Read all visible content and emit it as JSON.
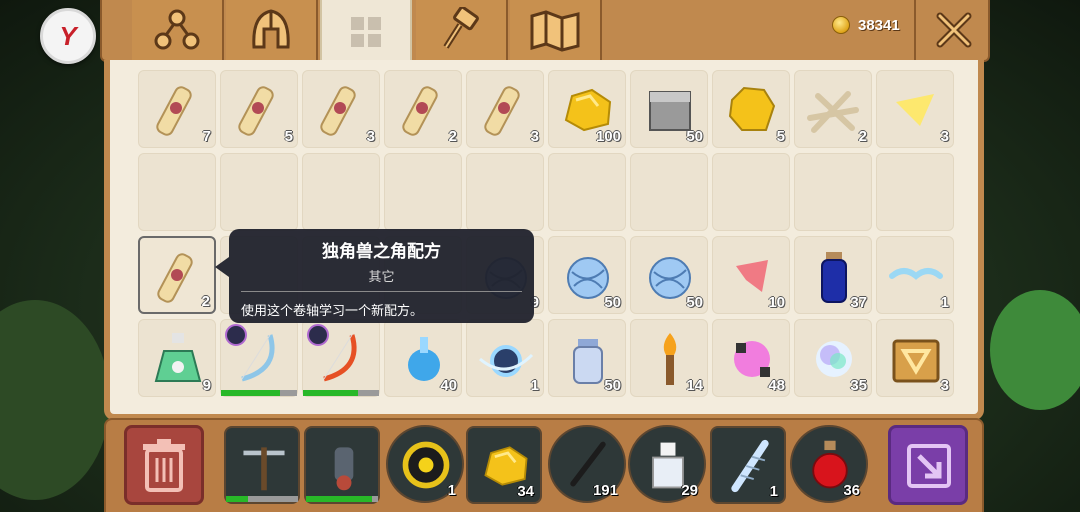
{
  "currency": {
    "coins": "38341",
    "icon": "gold-coin-icon"
  },
  "tabs": [
    {
      "name": "tab-skills",
      "icon": "skill-tree-icon"
    },
    {
      "name": "tab-equipment",
      "icon": "helmet-icon"
    },
    {
      "name": "tab-inventory",
      "icon": "grid-icon",
      "active": true
    },
    {
      "name": "tab-crafting",
      "icon": "hammer-icon"
    },
    {
      "name": "tab-map",
      "icon": "map-icon"
    }
  ],
  "inventory": {
    "rows": [
      [
        {
          "item": "scroll",
          "count": "7"
        },
        {
          "item": "scroll",
          "count": "5"
        },
        {
          "item": "scroll",
          "count": "3"
        },
        {
          "item": "scroll",
          "count": "2"
        },
        {
          "item": "scroll",
          "count": "3"
        },
        {
          "item": "gold-ore",
          "count": "100"
        },
        {
          "item": "stone-block",
          "count": "50"
        },
        {
          "item": "yellow-chunk",
          "count": "5"
        },
        {
          "item": "bones",
          "count": "2"
        },
        {
          "item": "yellow-shard",
          "count": "3"
        }
      ],
      [
        {
          "item": "",
          "count": ""
        },
        {
          "item": "",
          "count": ""
        },
        {
          "item": "",
          "count": ""
        },
        {
          "item": "",
          "count": ""
        },
        {
          "item": "",
          "count": ""
        },
        {
          "item": "",
          "count": ""
        },
        {
          "item": "",
          "count": ""
        },
        {
          "item": "",
          "count": ""
        },
        {
          "item": "",
          "count": ""
        },
        {
          "item": "",
          "count": ""
        }
      ],
      [
        {
          "item": "scroll",
          "count": "2",
          "selected": true
        },
        {
          "item": "hidden",
          "count": ""
        },
        {
          "item": "hidden",
          "count": ""
        },
        {
          "item": "hidden",
          "count": ""
        },
        {
          "item": "yarn",
          "count": "9"
        },
        {
          "item": "yarn",
          "count": "50"
        },
        {
          "item": "yarn",
          "count": "50"
        },
        {
          "item": "pink-cloth",
          "count": "10"
        },
        {
          "item": "blue-vial",
          "count": "37"
        },
        {
          "item": "wing",
          "count": "1"
        }
      ],
      [
        {
          "item": "green-potion",
          "count": "9"
        },
        {
          "item": "lightning-bow",
          "count": "",
          "durability": 0.78
        },
        {
          "item": "fire-bow",
          "count": "",
          "durability": 0.72
        },
        {
          "item": "blue-bomb",
          "count": "40"
        },
        {
          "item": "ghost-orb",
          "count": "1"
        },
        {
          "item": "jar",
          "count": "50"
        },
        {
          "item": "torch",
          "count": "14"
        },
        {
          "item": "pink-crystal",
          "count": "48"
        },
        {
          "item": "rainbow-orb",
          "count": "35"
        },
        {
          "item": "rune-box",
          "count": "3"
        }
      ]
    ]
  },
  "tooltip": {
    "title": "独角兽之角配方",
    "category": "其它",
    "description": "使用这个卷轴学习一个新配方。"
  },
  "hotbar": [
    {
      "item": "crossbow",
      "count": "",
      "durability": 0.3
    },
    {
      "item": "cannon",
      "count": "",
      "durability": 0.92
    },
    {
      "item": "gold-ring-orb",
      "count": "1"
    },
    {
      "item": "gold-ore",
      "count": "34"
    },
    {
      "item": "stick",
      "count": "191"
    },
    {
      "item": "white-bottle",
      "count": "29"
    },
    {
      "item": "fish-bone",
      "count": "1"
    },
    {
      "item": "red-potion",
      "count": "36"
    }
  ]
}
